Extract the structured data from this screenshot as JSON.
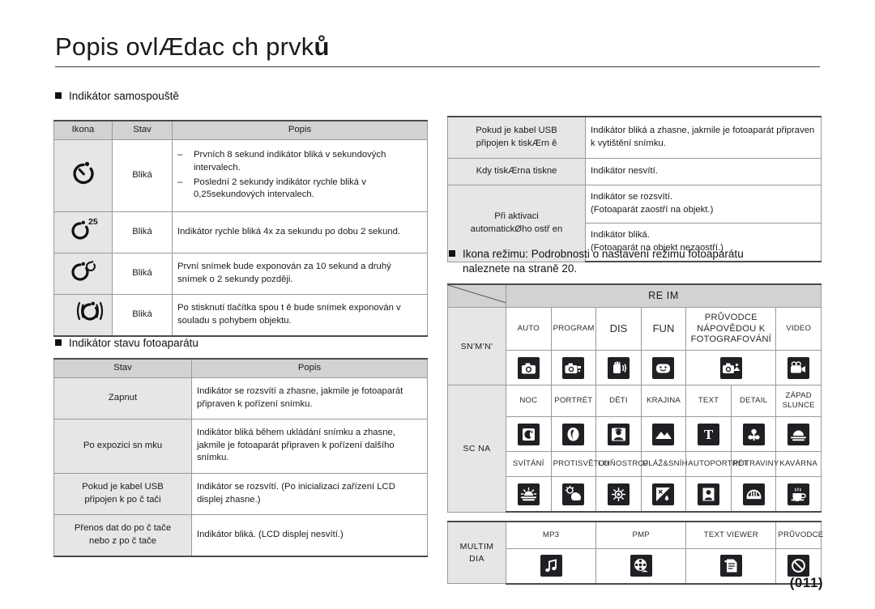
{
  "header": {
    "title_plain": "Popis ovlÆdac ch prvk",
    "title_bold_tail": "ů",
    "page_number": "(011)"
  },
  "sections": {
    "self_timer": {
      "heading": "Indikátor samospouště"
    },
    "camera_status": {
      "heading": "Indikátor stavu fotoaparátu"
    },
    "mode_icon": {
      "heading_line1": "Ikona režimu: Podrobnosti o nastavení režimu fotoaparátu",
      "heading_line2": "naleznete na straně 20."
    }
  },
  "self_timer_table": {
    "columns": [
      "Ikona",
      "Stav",
      "Popis"
    ],
    "rows": [
      {
        "icon": "self-timer-10s-icon",
        "state": "Bliká",
        "desc_items": [
          "Prvních 8 sekund indikátor bliká v sekundových intervalech.",
          "Poslední 2 sekundy indikátor rychle bliká v 0,25sekundových intervalech."
        ]
      },
      {
        "icon": "self-timer-2s-icon",
        "state": "Bliká",
        "desc": "Indikátor rychle bliká 4x za sekundu po dobu 2 sekund."
      },
      {
        "icon": "self-timer-double-icon",
        "state": "Bliká",
        "desc": "První snímek bude exponován za 10 sekund a druhý snímek o 2 sekundy později."
      },
      {
        "icon": "self-timer-motion-icon",
        "state": "Bliká",
        "desc": "Po stisknutí tlačítka spou t ě bude snímek exponován v souladu s pohybem objektu."
      }
    ]
  },
  "camera_status_table": {
    "columns": [
      "Stav",
      "Popis"
    ],
    "rows": [
      {
        "state": "Zapnut",
        "desc": "Indikátor se rozsvítí a zhasne, jakmile je fotoaparát připraven k pořízení snímku."
      },
      {
        "state": "Po expozici sn mku",
        "desc": "Indikátor bliká během ukládání snímku a zhasne, jakmile je fotoaparát připraven k pořízení dalšího snímku."
      },
      {
        "state_line1": "Pokud je kabel USB",
        "state_line2": "připojen k po č tači",
        "desc": "Indikátor se rozsvítí. (Po inicializaci zařízení LCD displej zhasne.)"
      },
      {
        "state_line1": "Přenos dat do po č tače",
        "state_line2": "nebo z po č tače",
        "desc": "Indikátor bliká. (LCD displej nesvítí.)"
      }
    ]
  },
  "printer_status_table": {
    "rows": [
      {
        "state_line1": "Pokud je kabel USB",
        "state_line2": "připojen k tiskÆrn ě",
        "desc": "Indikátor bliká a zhasne, jakmile je fotoaparát připraven k vytištění snímku."
      },
      {
        "state_line1": "Kdy tiskÆrna tiskne",
        "state_line2": "",
        "desc": "Indikátor nesvítí."
      },
      {
        "state_line1": "Při aktivaci",
        "state_line2": "automatickØho ostř en",
        "desc_a_line1": "Indikátor se rozsvítí.",
        "desc_a_line2": "(Fotoaparát zaostří na objekt.)",
        "desc_b_line1": "Indikátor bliká.",
        "desc_b_line2": "(Fotoaparát na objekt nezaostří.)"
      }
    ]
  },
  "mode_table": {
    "banner": "RE IM",
    "groups": [
      {
        "label": "SN'M'N'",
        "items": [
          {
            "label": "AUTO",
            "icon": "camera-auto-icon"
          },
          {
            "label": "PROGRAM",
            "icon": "camera-program-icon"
          },
          {
            "label": "DIS",
            "icon": "hand-shake-icon"
          },
          {
            "label": "FUN",
            "icon": "smiley-face-icon"
          },
          {
            "label": "PRŮVODCE NÁPOVĚDOU K FOTOGRAFOVÁNÍ",
            "icon": "camera-help-icon"
          },
          {
            "label": "VIDEO",
            "icon": "movie-camera-icon"
          }
        ]
      },
      {
        "label": "SC NA",
        "rows": [
          [
            {
              "label": "NOC",
              "icon": "night-moon-icon"
            },
            {
              "label": "PORTRÉT",
              "icon": "portrait-icon"
            },
            {
              "label": "DĚTI",
              "icon": "children-icon"
            },
            {
              "label": "KRAJINA",
              "icon": "landscape-icon"
            },
            {
              "label": "TEXT",
              "icon": "text-t-icon"
            },
            {
              "label": "DETAIL",
              "icon": "macro-flower-icon"
            },
            {
              "label": "ZÁPAD SLUNCE",
              "icon": "sunset-icon"
            }
          ],
          [
            {
              "label": "SVÍTÁNÍ",
              "icon": "dawn-icon"
            },
            {
              "label": "PROTISVĚTLO",
              "icon": "backlight-icon"
            },
            {
              "label": "OHŇOSTROJ",
              "icon": "fireworks-icon"
            },
            {
              "label": "PLÁŽ&SNÍH",
              "icon": "beach-snow-icon"
            },
            {
              "label": "AUTOPORTRÉT",
              "icon": "self-portrait-icon"
            },
            {
              "label": "POTRAVINY",
              "icon": "food-icon"
            },
            {
              "label": "KAVÁRNA",
              "icon": "cafe-cup-icon"
            }
          ]
        ]
      },
      {
        "label": "MULTIM DIA",
        "items": [
          {
            "label": "MP3",
            "icon": "music-note-icon"
          },
          {
            "label": "PMP",
            "icon": "film-reel-icon"
          },
          {
            "label": "TEXT VIEWER",
            "icon": "text-document-icon"
          },
          {
            "label": "PRŮVODCE",
            "icon": "no-entry-icon"
          }
        ]
      }
    ]
  },
  "colors": {
    "header_gray": "#d2d2d2",
    "cell_gray": "#e6e6e6",
    "icon_black": "#221f24",
    "rule": "#3a3a3a"
  }
}
